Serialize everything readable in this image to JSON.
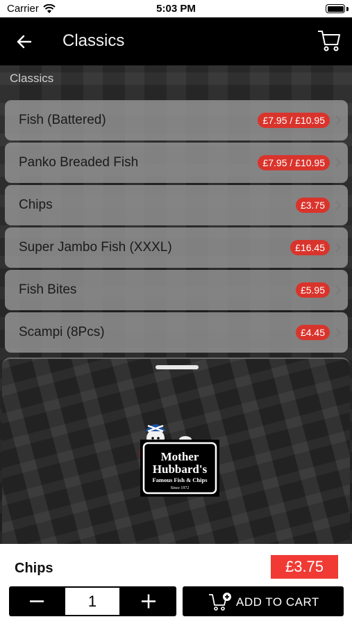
{
  "status_bar": {
    "carrier": "Carrier",
    "time": "5:03 PM"
  },
  "nav": {
    "title": "Classics"
  },
  "section": {
    "header": "Classics"
  },
  "menu": {
    "items": [
      {
        "name": "Fish (Battered)",
        "price": "£7.95 / £10.95"
      },
      {
        "name": "Panko Breaded Fish",
        "price": "£7.95 / £10.95"
      },
      {
        "name": "Chips",
        "price": "£3.75"
      },
      {
        "name": "Super Jambo Fish (XXXL)",
        "price": "£16.45"
      },
      {
        "name": "Fish Bites",
        "price": "£5.95"
      },
      {
        "name": "Scampi (8Pcs)",
        "price": "£4.45"
      }
    ]
  },
  "logo": {
    "line1": "Mother",
    "line2": "Hubbard's",
    "line3": "Famous Fish & Chips",
    "line4": "Since 1972"
  },
  "product": {
    "name": "Chips",
    "price": "£3.75",
    "quantity": "1",
    "add_to_cart_label": "ADD TO CART"
  },
  "colors": {
    "price_badge": "#d9342c",
    "price_box": "#f03a33",
    "nav_bg": "#000000"
  },
  "icons": [
    "wifi-icon",
    "battery-icon",
    "back-arrow-icon",
    "cart-icon",
    "chevron-right-icon",
    "minus-icon",
    "plus-icon",
    "add-to-cart-icon"
  ]
}
